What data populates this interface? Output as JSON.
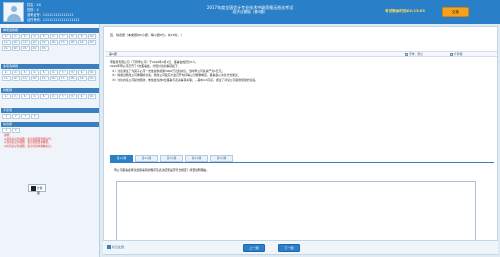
{
  "candidate": {
    "name_line": "姓名：XX",
    "gender_line": "性别：X",
    "exam_no_line": "准考证号：111111111111111",
    "id_no_line": "证件号码：111111111111111111"
  },
  "header": {
    "title_line1": "2017年度全国会计专业技术中级资格无纸化考试",
    "title_line2": "经济法基础（第5题）",
    "title_line3": "",
    "timer_label": "考试剩余时间：",
    "timer_value": "02:13:03",
    "submit_label": "交卷"
  },
  "sidebar": {
    "sections": [
      {
        "title": "单项选择题",
        "items": [
          "1√",
          "2√",
          "3√",
          "4√",
          "5√",
          "6√",
          "7√",
          "8√",
          "9√",
          "10√",
          "11√",
          "12√",
          "13√",
          "14√",
          "15√",
          "16√",
          "17√",
          "18√",
          "19√",
          "20√",
          "21√",
          "22√",
          "23√",
          "24√",
          "25√"
        ]
      },
      {
        "title": "多项选择题",
        "items": [
          "1√",
          "2√",
          "3√",
          "4√",
          "5√",
          "6√",
          "7√",
          "8√",
          "9√",
          "10√",
          "11√",
          "12√",
          "13√",
          "14√",
          "15√",
          "16√",
          "17√",
          "18√",
          "19√",
          "20√"
        ]
      },
      {
        "title": "判断题",
        "items": [
          "1√",
          "2√",
          "3√",
          "4√",
          "5√",
          "6√",
          "7√",
          "8√",
          "9√",
          "10√"
        ]
      },
      {
        "title": "不定项",
        "items": [
          "1",
          "2",
          "3",
          "4"
        ]
      },
      {
        "title": "综合题",
        "items": [
          "1",
          "2"
        ]
      }
    ],
    "legend_lines": [
      "说明：",
      "以蓝色标记的试题：表示该题目答题完毕。",
      "以灰色标记的试题：表示该题目未做答。",
      "以红色标记的试题：表示考试内容被标记。"
    ],
    "calculator_label": "计算器"
  },
  "main": {
    "instruction": "四、综合题（本类题共5小题，每小题9分，共18分。）",
    "question_number": "第1题",
    "tools": [
      {
        "label": "字体：默认",
        "icon": "font-icon"
      },
      {
        "label": "计算器",
        "icon": "calculator-icon"
      }
    ],
    "stem_lines": [
      "甲股份有限公司（下称甲公司）于2016年3月1日，董事会成员为7人。",
      "2016年甲公司召开了3次董事会，分别讨论的事项如下：",
      "（1）讨论通过了为其子公司一次性提供担保3000万元的决议，当时甲公司总资产为1亿元；",
      "（2）拟通过修改公司章程的议案，修改公司股东大会召开时间等公司规章制度，董事会以决议方式通过，",
      "（3）讨论向某公司提供借款，参加会议的6位董事与表决事项关联；...其中4人同意，通过了对某公司提供借款的议案。"
    ],
    "sub_tabs": [
      "第1小题",
      "第2小题",
      "第3小题",
      "第4小题",
      "第5小题"
    ],
    "active_sub_tab": 0,
    "sub_question": "甲公司董事会审议担保事项的程序及表决结果是否符合规定？简要说明理由。",
    "answer_value": ""
  },
  "footer": {
    "mark_label": "标记此题",
    "prev_label": "上一题",
    "next_label": "下一题"
  }
}
